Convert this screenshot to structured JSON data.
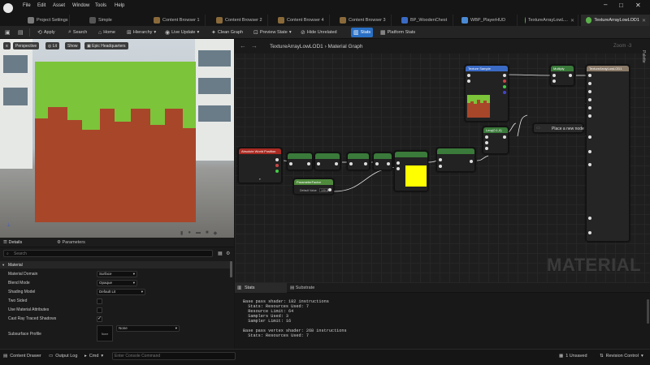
{
  "menu": {
    "items": [
      "File",
      "Edit",
      "Asset",
      "Window",
      "Tools",
      "Help"
    ]
  },
  "project": {
    "settings_label": "Project Settings",
    "simple_label": "Simple"
  },
  "tabs": [
    {
      "label": "Content Browser 1"
    },
    {
      "label": "Content Browser 2"
    },
    {
      "label": "Content Browser 4"
    },
    {
      "label": "Content Browser 3"
    },
    {
      "label": "BP_WoodenChest"
    },
    {
      "label": "WBP_PlayerHUD"
    },
    {
      "label": "TextureArrayLowL..."
    },
    {
      "label": "TextureArrayLowLOD1"
    }
  ],
  "toolbar": {
    "apply": "Apply",
    "search": "Search",
    "home": "Home",
    "hierarchy": "Hierarchy",
    "live_update": "Live Update",
    "clean_graph": "Clean Graph",
    "preview_state": "Preview State",
    "hide_unrelated": "Hide Unrelated",
    "stats": "Stats",
    "platform_stats": "Platform Stats"
  },
  "viewport": {
    "perspective": "Perspective",
    "lit": "Lit",
    "show": "Show",
    "hq": "Epic Headquarters"
  },
  "details": {
    "tab_details": "Details",
    "tab_parameters": "Parameters",
    "search_placeholder": "Search",
    "section": "Material",
    "rows": [
      {
        "label": "Material Domain",
        "value": "Surface"
      },
      {
        "label": "Blend Mode",
        "value": "Opaque"
      },
      {
        "label": "Shading Model",
        "value": "Default Lit"
      },
      {
        "label": "Two Sided"
      },
      {
        "label": "Use Material Attributes"
      },
      {
        "label": "Cast Ray Traced Shadows"
      },
      {
        "label": "Subsurface Profile",
        "value": "None",
        "thumb": "None"
      }
    ]
  },
  "graph": {
    "breadcrumb_asset": "TextureArrayLowLOD1",
    "breadcrumb_graph": "Material Graph",
    "zoom": "Zoom -3",
    "palette": "Palette",
    "watermark": "MATERIAL",
    "place_node": "Place a new node",
    "nodes": {
      "absolute": "Absolute World Position",
      "param": "ParameterFactor",
      "param_default": "Default Value",
      "param_value": "100.0",
      "texture": "Texture Sample",
      "multiply": "Multiply",
      "lerp": "Lerp(0.1,0)",
      "main": "TextureArrayLowLOD1"
    }
  },
  "stats": {
    "tab_stats": "Stats",
    "tab_substrate": "Substrate",
    "lines": [
      "Base pass shader: 182 instructions",
      "  Stats: Resources Used: 7",
      "  Resource Limit: 64",
      "  Samplers Used: 3",
      "  Sampler Limit: 16",
      "",
      "Base pass vertex shader: 268 instructions",
      "  Stats: Resources Used: 7"
    ]
  },
  "statusbar": {
    "content_drawer": "Content Drawer",
    "output_log": "Output Log",
    "cmd": "Cmd",
    "console_placeholder": "Enter Console Command",
    "unsaved": "1 Unsaved",
    "revision": "Revision Control"
  },
  "colors": {
    "accent": "#2a6fc4",
    "grass": "#7cc43a",
    "dirt": "#a8462a",
    "preview_yellow": "#ffff00"
  }
}
